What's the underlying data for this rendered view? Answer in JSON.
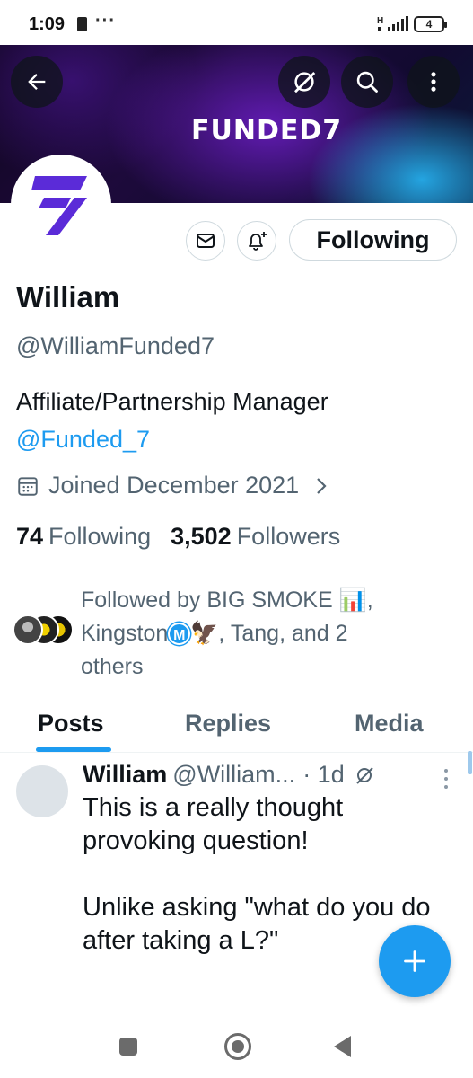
{
  "status_bar": {
    "time": "1:09",
    "dots": "···",
    "network": "H",
    "battery": "4"
  },
  "banner": {
    "logo_text": "FUNDED7"
  },
  "profile": {
    "name": "William",
    "handle": "@WilliamFunded7",
    "bio": "Affiliate/Partnership Manager",
    "bio_mention": "@Funded_7",
    "joined": "Joined December 2021",
    "following_count": "74",
    "following_label": "Following",
    "followers_count": "3,502",
    "followers_label": "Followers",
    "follow_button_label": "Following"
  },
  "followed_by": {
    "line1": "Followed by BIG SMOKE 📊,",
    "kingston": "Kingston",
    "badge": "M",
    "line2_rest": "🦅, Tang, and 2",
    "line3": "others"
  },
  "tabs": [
    {
      "label": "Posts",
      "active": true
    },
    {
      "label": "Replies",
      "active": false
    },
    {
      "label": "Media",
      "active": false
    }
  ],
  "post": {
    "author": "William",
    "handle": "@William...",
    "time": "· 1d",
    "text": "This is a really thought provoking question!\n\nUnlike asking \"what do you do after taking a L?\""
  },
  "colors": {
    "accent": "#1d9bf0",
    "text_secondary": "#536471",
    "brand_purple": "#5b2bd8"
  }
}
